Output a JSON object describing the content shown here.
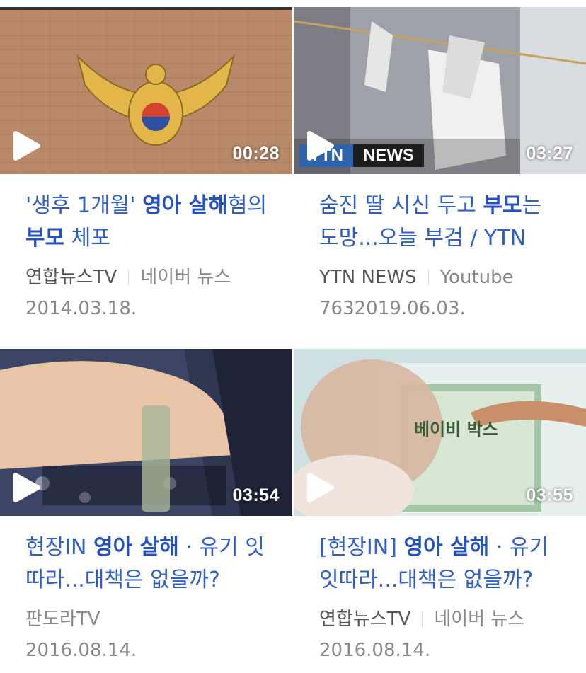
{
  "videos": [
    {
      "duration": "00:28",
      "title_parts": [
        {
          "text": "'생후 1개월' ",
          "bold": false
        },
        {
          "text": "영아 살해",
          "bold": true
        },
        {
          "text": "혐의 ",
          "bold": false
        },
        {
          "text": "부모",
          "bold": true
        },
        {
          "text": " 체포",
          "bold": false
        }
      ],
      "source": "연합뉴스TV",
      "platform": "네이버 뉴스",
      "date": "2014.03.18."
    },
    {
      "duration": "03:27",
      "overlay_logo": "YTN",
      "overlay_label": "NEWS",
      "title_parts": [
        {
          "text": "숨진 딸 시신 두고 ",
          "bold": false
        },
        {
          "text": "부모",
          "bold": true
        },
        {
          "text": "는 도망...오늘 부검 / YTN",
          "bold": false
        }
      ],
      "source": "YTN NEWS",
      "platform": "Youtube",
      "views": "763",
      "date": "2019.06.03."
    },
    {
      "duration": "03:54",
      "title_parts": [
        {
          "text": "현장IN ",
          "bold": false
        },
        {
          "text": "영아 살해",
          "bold": true
        },
        {
          "text": " · 유기 잇따라...대책은 없을까?",
          "bold": false
        }
      ],
      "source": "판도라TV",
      "date": "2016.08.14."
    },
    {
      "duration": "03:55",
      "overlay_text": "베이비 박스",
      "title_parts": [
        {
          "text": "[현장IN] ",
          "bold": false
        },
        {
          "text": "영아 살해",
          "bold": true
        },
        {
          "text": " · 유기 잇따라...대책은 없을까?",
          "bold": false
        }
      ],
      "source": "연합뉴스TV",
      "platform": "네이버 뉴스",
      "date": "2016.08.14."
    }
  ]
}
